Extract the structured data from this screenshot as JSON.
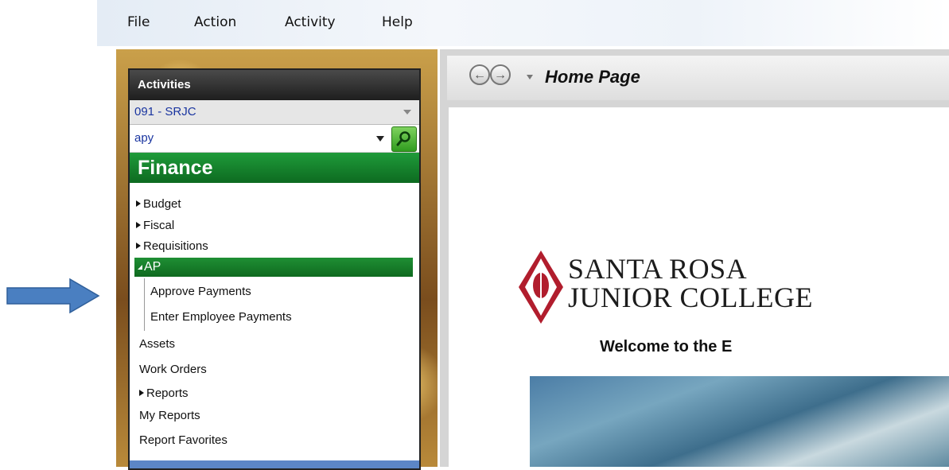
{
  "menu": [
    "File",
    "Action",
    "Activity",
    "Help"
  ],
  "activities": {
    "header": "Activities",
    "district": "091 - SRJC",
    "search_value": "apy"
  },
  "finance": {
    "title": "Finance",
    "items": [
      "Budget",
      "Fiscal",
      "Requisitions"
    ],
    "ap": {
      "label": "AP",
      "children": [
        "Approve Payments",
        "Enter Employee Payments"
      ]
    },
    "more": [
      "Assets",
      "Work Orders"
    ],
    "reports": "Reports",
    "my_reports": "My Reports",
    "report_favorites": "Report Favorites"
  },
  "browser": {
    "title": "Home Page"
  },
  "page": {
    "logo_line1": "SANTA ROSA",
    "logo_line2": "JUNIOR COLLEGE",
    "welcome": "Welcome to the E"
  },
  "colors": {
    "finance_green": "#0d6a20",
    "link_blue": "#1a35a0",
    "arrow_blue": "#4a7fc1",
    "logo_red": "#b11d2d"
  },
  "icons": [
    "back-icon",
    "forward-icon",
    "search-icon",
    "college-logo-icon",
    "pointer-arrow-icon"
  ]
}
